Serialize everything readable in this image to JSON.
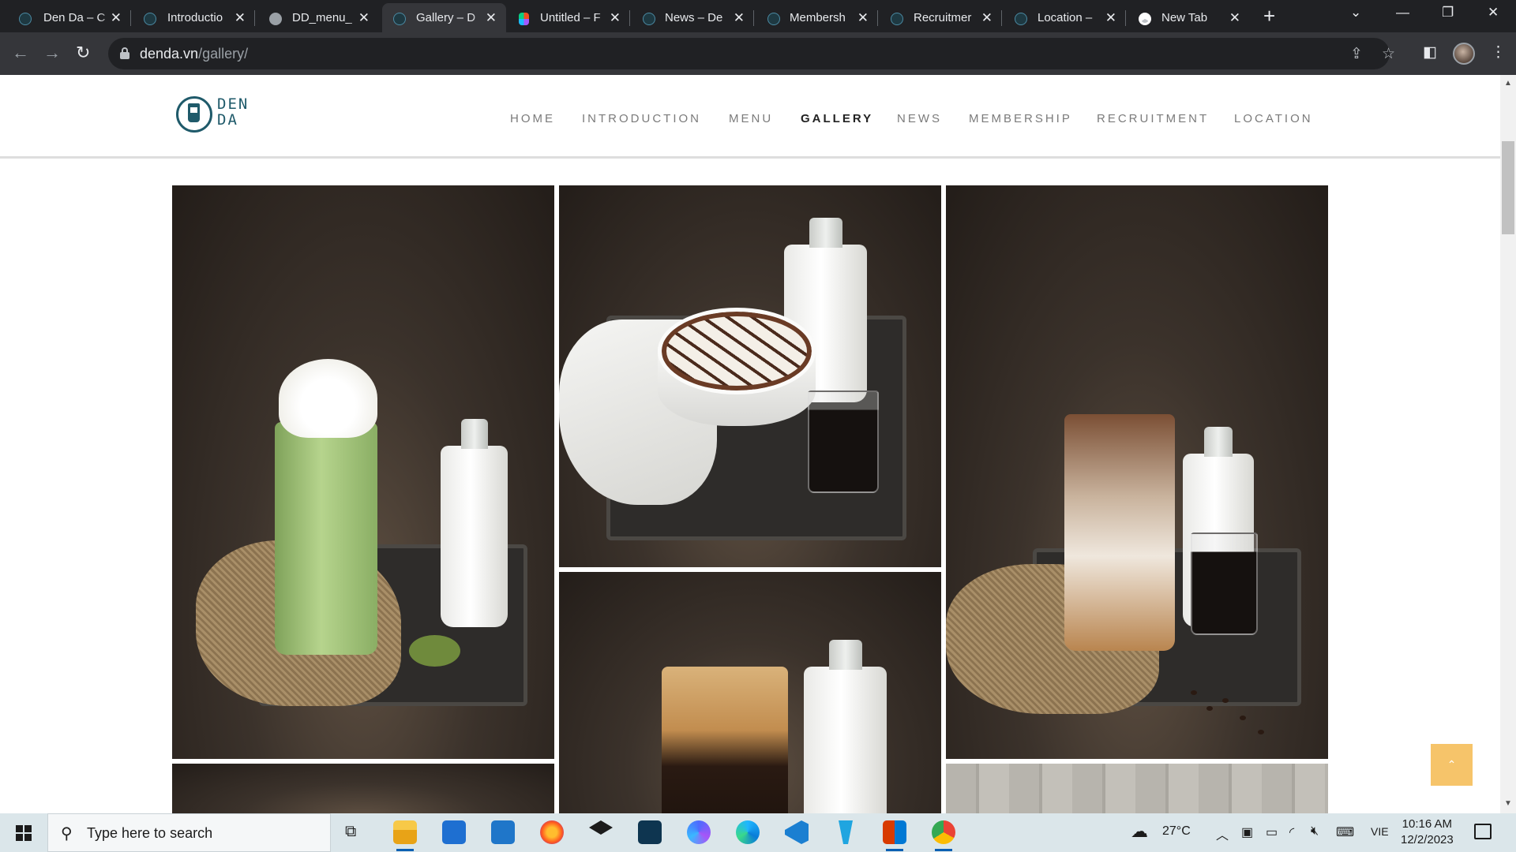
{
  "browser": {
    "tabs": [
      {
        "title": "Den Da – C",
        "favicon": "denda-icon"
      },
      {
        "title": "Introductio",
        "favicon": "denda-icon"
      },
      {
        "title": "DD_menu_",
        "favicon": "globe-icon"
      },
      {
        "title": "Gallery – D",
        "favicon": "denda-icon",
        "active": true
      },
      {
        "title": "Untitled – F",
        "favicon": "figma-icon"
      },
      {
        "title": "News – De",
        "favicon": "denda-icon"
      },
      {
        "title": "Membersh",
        "favicon": "denda-icon"
      },
      {
        "title": "Recruitmer",
        "favicon": "denda-icon"
      },
      {
        "title": "Location –",
        "favicon": "denda-icon"
      },
      {
        "title": "New Tab",
        "favicon": "chrome-icon"
      }
    ],
    "close_glyph": "✕",
    "newtab_glyph": "+",
    "url_host": "denda.vn",
    "url_path": "/gallery/"
  },
  "site": {
    "logo_line1": "DEN",
    "logo_line2": "DA",
    "nav": [
      {
        "label": "HOME"
      },
      {
        "label": "INTRODUCTION"
      },
      {
        "label": "MENU"
      },
      {
        "label": "GALLERY",
        "active": true
      },
      {
        "label": "NEWS"
      },
      {
        "label": "MEMBERSHIP"
      },
      {
        "label": "RECRUITMENT"
      },
      {
        "label": "LOCATION"
      }
    ],
    "gallery_photos": [
      "matcha-frappe-photo",
      "cappuccino-photo",
      "iced-latte-photo",
      "iced-coffee-photo"
    ],
    "back_to_top_glyph": "⌃",
    "accent_color": "#f6c46a",
    "brand_color": "#1f5a6a"
  },
  "taskbar": {
    "search_placeholder": "Type here to search",
    "weather": "27°C",
    "language": "VIE",
    "time": "10:16 AM",
    "date": "12/2/2023"
  }
}
